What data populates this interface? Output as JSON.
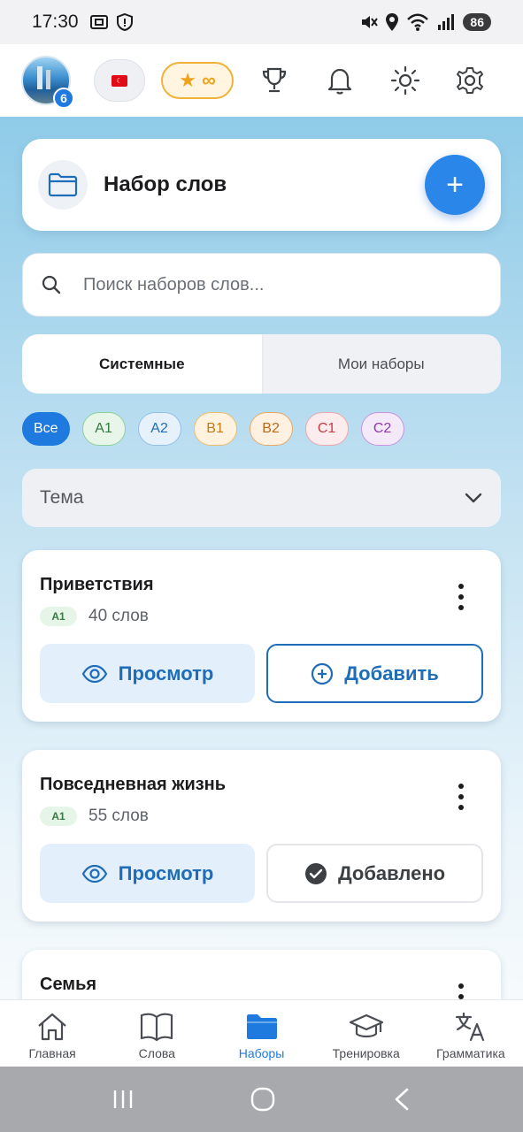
{
  "status_bar": {
    "time": "17:30",
    "battery": "86"
  },
  "top_bar": {
    "avatar_badge": "6",
    "premium_star": "★",
    "premium_infinity": "∞"
  },
  "header": {
    "title": "Набор слов",
    "add_symbol": "+"
  },
  "search": {
    "placeholder": "Поиск наборов слов..."
  },
  "segments": [
    {
      "label": "Системные",
      "active": true
    },
    {
      "label": "Мои наборы",
      "active": false
    }
  ],
  "level_chips": [
    {
      "label": "Все",
      "bg": "#1f7ae0",
      "border": "#1f7ae0",
      "color": "#ffffff"
    },
    {
      "label": "A1",
      "bg": "#e8f6ea",
      "border": "#8fcf9a",
      "color": "#2f7a3c"
    },
    {
      "label": "A2",
      "bg": "#e6f1fb",
      "border": "#93c0ea",
      "color": "#1f6db8"
    },
    {
      "label": "B1",
      "bg": "#fff3e0",
      "border": "#f0bb6a",
      "color": "#c77a12"
    },
    {
      "label": "B2",
      "bg": "#fff1e2",
      "border": "#eba766",
      "color": "#bd6a17"
    },
    {
      "label": "C1",
      "bg": "#fdeced",
      "border": "#eea7ad",
      "color": "#c23b47"
    },
    {
      "label": "C2",
      "bg": "#f4e9f8",
      "border": "#c795df",
      "color": "#8e3aae"
    }
  ],
  "topic_dropdown": {
    "label": "Тема"
  },
  "cards": [
    {
      "title": "Приветствия",
      "level": "A1",
      "count": "40 слов",
      "view_label": "Просмотр",
      "action_label": "Добавить",
      "added": false
    },
    {
      "title": "Повседневная жизнь",
      "level": "A1",
      "count": "55 слов",
      "view_label": "Просмотр",
      "action_label": "Добавлено",
      "added": true
    },
    {
      "title": "Семья",
      "level": "",
      "count": "",
      "view_label": "",
      "action_label": "",
      "added": false
    }
  ],
  "bottom_nav": [
    {
      "label": "Главная",
      "icon": "home-icon",
      "active": false
    },
    {
      "label": "Слова",
      "icon": "book-icon",
      "active": false
    },
    {
      "label": "Наборы",
      "icon": "folder-icon",
      "active": true
    },
    {
      "label": "Тренировка",
      "icon": "graduation-cap-icon",
      "active": false
    },
    {
      "label": "Грамматика",
      "icon": "translate-icon",
      "active": false
    }
  ],
  "colors": {
    "accent": "#1f7ae0",
    "primary_button": "#1f6db8",
    "premium": "#f0a21b"
  }
}
